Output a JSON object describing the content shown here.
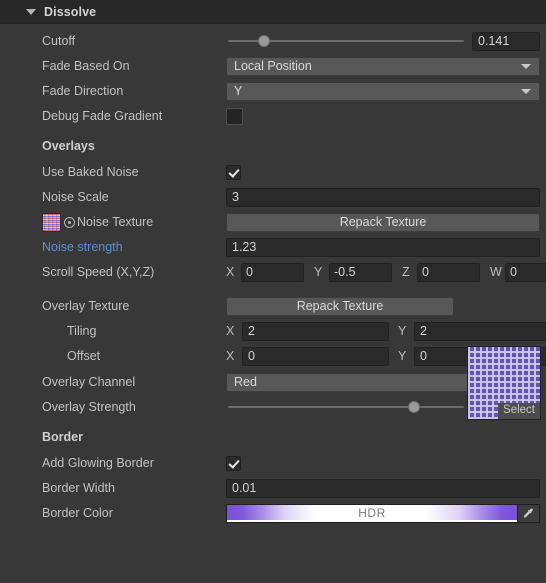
{
  "header": {
    "title": "Dissolve",
    "foldout_icon": "triangle-down-icon",
    "expanded": true
  },
  "fields": {
    "cutoff": {
      "label": "Cutoff",
      "value": "0.141",
      "slider_percent": 14.1,
      "type": "slider"
    },
    "fade_based_on": {
      "label": "Fade Based On",
      "value": "Local Position",
      "type": "dropdown"
    },
    "fade_direction": {
      "label": "Fade Direction",
      "value": "Y",
      "type": "dropdown"
    },
    "debug_fade_gradient": {
      "label": "Debug Fade Gradient",
      "value": "",
      "type": "color-swatch",
      "color": "#242424"
    }
  },
  "overlays": {
    "section_title": "Overlays",
    "use_baked_noise": {
      "label": "Use Baked Noise",
      "checked": true
    },
    "noise_scale": {
      "label": "Noise Scale",
      "value": "3"
    },
    "noise_texture": {
      "label": "Noise Texture",
      "button_label": "Repack Texture",
      "thumbnail": "noise-texture-thumbnail"
    },
    "noise_strength": {
      "label": "Noise strength",
      "value": "1.23",
      "label_color": "#5d8fd4"
    },
    "scroll_speed": {
      "label": "Scroll Speed (X,Y,Z)",
      "components": [
        {
          "axis": "X",
          "value": "0"
        },
        {
          "axis": "Y",
          "value": "-0.5"
        },
        {
          "axis": "Z",
          "value": "0"
        },
        {
          "axis": "W",
          "value": "0"
        }
      ]
    },
    "overlay_texture": {
      "label": "Overlay Texture",
      "button_label": "Repack Texture",
      "preview_select_label": "Select",
      "preview_color": "#6354b4"
    },
    "tiling": {
      "label": "Tiling",
      "x_axis": "X",
      "x_value": "2",
      "y_axis": "Y",
      "y_value": "2"
    },
    "offset": {
      "label": "Offset",
      "x_axis": "X",
      "x_value": "0",
      "y_axis": "Y",
      "y_value": "0"
    },
    "overlay_channel": {
      "label": "Overlay Channel",
      "value": "Red"
    },
    "overlay_strength": {
      "label": "Overlay Strength",
      "value": "0.799",
      "slider_percent": 79.9
    }
  },
  "border": {
    "section_title": "Border",
    "add_glowing_border": {
      "label": "Add Glowing Border",
      "checked": true
    },
    "border_width": {
      "label": "Border Width",
      "value": "0.01"
    },
    "border_color": {
      "label": "Border Color",
      "hdr_label": "HDR",
      "eyedropper_icon": "eyedropper-icon",
      "gradient_accent": "#7a52d8"
    }
  }
}
